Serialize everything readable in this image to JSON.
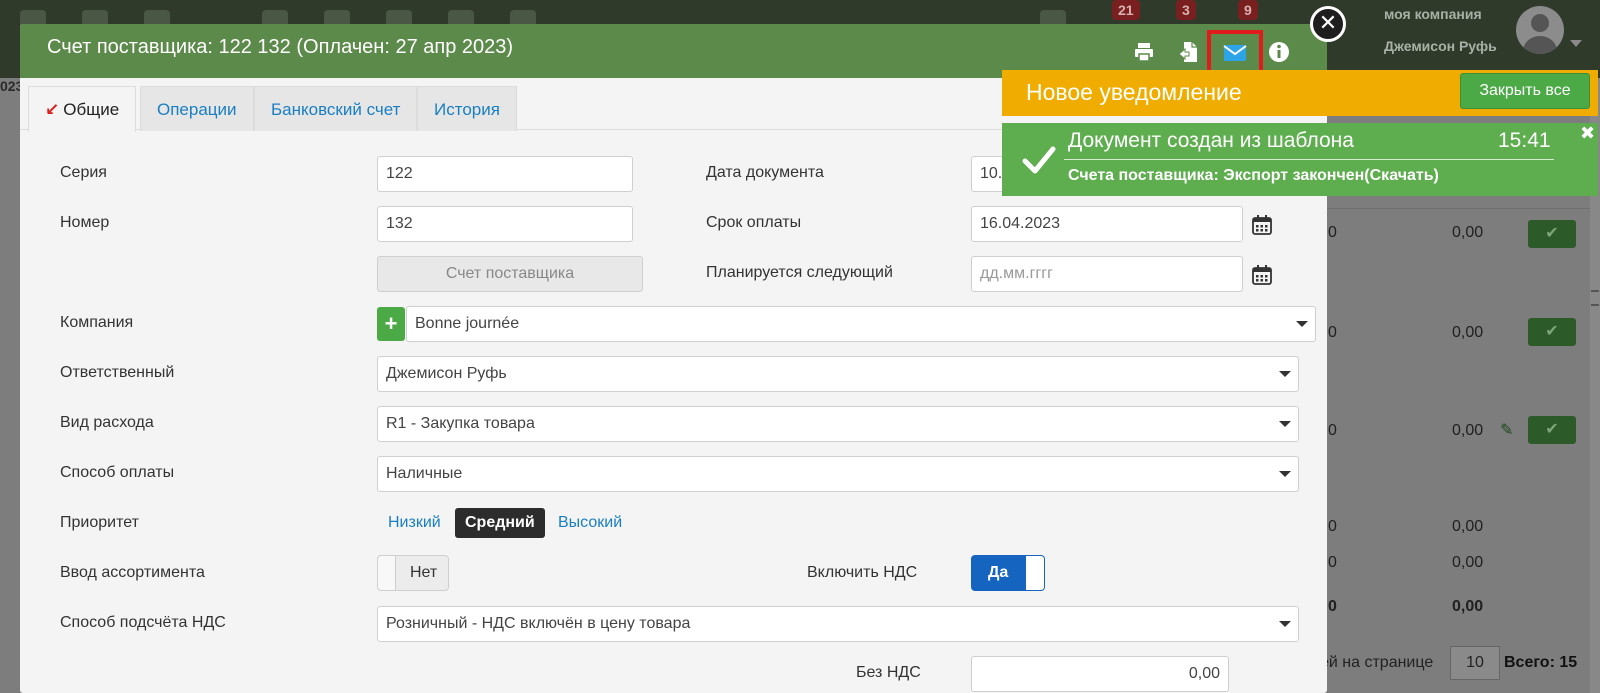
{
  "topbar": {
    "badges": [
      "21",
      "3",
      "9"
    ],
    "company": "моя компания",
    "user_name": "Джемисон Руфь"
  },
  "background": {
    "row_values": [
      "0,00",
      "0,00",
      "0,00",
      "0,00",
      "0,00",
      "0,00"
    ],
    "per_page_label": "ей на странице",
    "per_page_value": "10",
    "total": "Всего: 15"
  },
  "modal": {
    "title": "Счет поставщика: 122 132 (Оплачен: 27 апр 2023)",
    "tabs": [
      "Общие",
      "Операции",
      "Банковский счет",
      "История"
    ],
    "fields": {
      "series_label": "Серия",
      "series_value": "122",
      "number_label": "Номер",
      "number_value": "132",
      "doc_type_button": "Счет поставщика",
      "doc_date_label": "Дата документа",
      "doc_date_value": "10.",
      "due_label": "Срок оплаты",
      "due_value": "16.04.2023",
      "next_label": "Планируется следующий",
      "next_placeholder": "дд.мм.гггг",
      "company_label": "Компания",
      "company_value": "Bonne journée",
      "responsible_label": "Ответственный",
      "responsible_value": "Джемисон Руфь",
      "expense_label": "Вид расхода",
      "expense_value": "R1 - Закупка товара",
      "payment_label": "Способ оплаты",
      "payment_value": "Наличные",
      "priority_label": "Приоритет",
      "priority_options": [
        "Низкий",
        "Средний",
        "Высокий"
      ],
      "priority_selected": "Средний",
      "assortment_label": "Ввод ассортимента",
      "assortment_toggle": "Нет",
      "vat_include_label": "Включить НДС",
      "vat_include_toggle": "Да",
      "vat_method_label": "Способ подсчёта НДС",
      "vat_method_value": "Розничный - НДС включён в цену товара",
      "no_vat_label": "Без НДС",
      "no_vat_value": "0,00"
    }
  },
  "notifications": {
    "header": "Новое уведомление",
    "close_all": "Закрыть все",
    "toast": {
      "title": "Документ создан из шаблона",
      "time": "15:41",
      "body": "Счета поставщика: Экспорт закончен(Скачать)",
      "close": "✖"
    }
  },
  "colors": {
    "modal_header": "#5c8a4a",
    "notify_orange": "#f0ad00",
    "toast_green": "#5eae4f",
    "link_blue": "#1a7fc1",
    "highlight_red": "#e01b1b"
  }
}
